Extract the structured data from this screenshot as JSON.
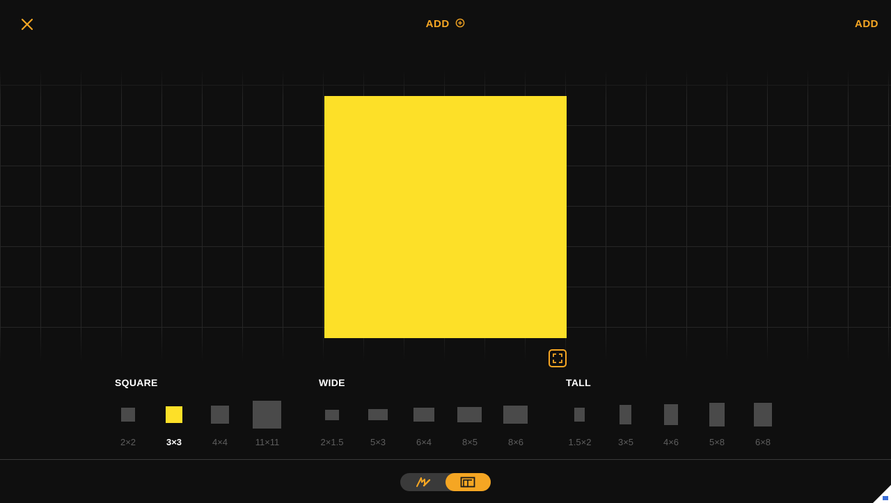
{
  "header": {
    "close_icon": "close-icon",
    "center_add_label": "ADD",
    "center_add_icon": "plus-circle-icon",
    "right_add_label": "ADD",
    "accent_color": "#f5a623"
  },
  "note": {
    "color": "#fde028",
    "resize_icon": "fullscreen-icon"
  },
  "size_picker": {
    "square": {
      "title": "SQUARE",
      "options": [
        {
          "label": "2×2"
        },
        {
          "label": "3×3",
          "selected": true
        },
        {
          "label": "4×4"
        },
        {
          "label": "11×11"
        }
      ]
    },
    "wide": {
      "title": "WIDE",
      "options": [
        {
          "label": "2×1.5"
        },
        {
          "label": "5×3"
        },
        {
          "label": "6×4"
        },
        {
          "label": "8×5"
        },
        {
          "label": "8×6"
        }
      ]
    },
    "tall": {
      "title": "TALL",
      "options": [
        {
          "label": "1.5×2"
        },
        {
          "label": "3×5"
        },
        {
          "label": "4×6"
        },
        {
          "label": "5×8"
        },
        {
          "label": "6×8"
        }
      ]
    }
  },
  "bottom_toggle": {
    "left_icon": "pen-scribble-icon",
    "right_icon": "layout-icon",
    "active": "right"
  }
}
